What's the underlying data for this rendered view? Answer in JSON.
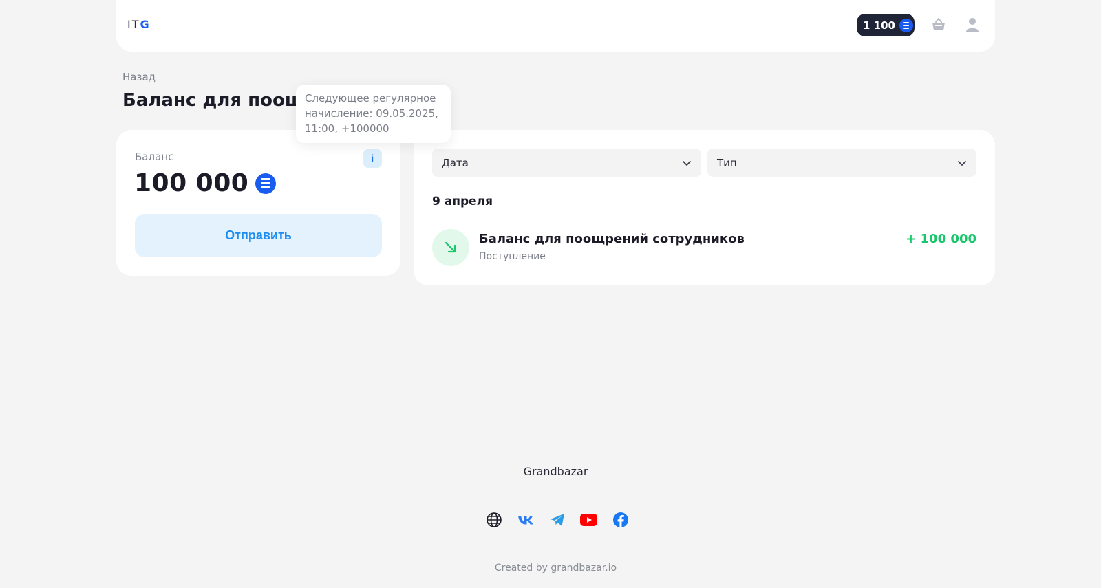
{
  "header": {
    "logo_prefix": "IT",
    "logo_accent": "G",
    "coin_balance": "1 100"
  },
  "page": {
    "back_label": "Назад",
    "title": "Баланс для поощрений сотрудников"
  },
  "tooltip": {
    "text": "Следующее регулярное начисление: 09.05.2025, 11:00, +100000"
  },
  "balance": {
    "label": "Баланс",
    "amount": "100 000",
    "info_label": "i",
    "send_label": "Отправить"
  },
  "filters": {
    "date_label": "Дата",
    "type_label": "Тип"
  },
  "transactions": {
    "date_heading": "9 апреля",
    "items": [
      {
        "title": "Баланс для поощрений сотрудников",
        "subtitle": "Поступление",
        "amount": "+ 100 000"
      }
    ]
  },
  "footer": {
    "brand": "Grandbazar",
    "credit": "Created by grandbazar.io",
    "socials": [
      "globe-icon",
      "vk-icon",
      "telegram-icon",
      "youtube-icon",
      "facebook-icon"
    ]
  },
  "colors": {
    "accent": "#1a5cf0",
    "positive": "#19c66b",
    "send_button_bg": "#e3f2fd",
    "send_button_text": "#1d8cf0"
  }
}
